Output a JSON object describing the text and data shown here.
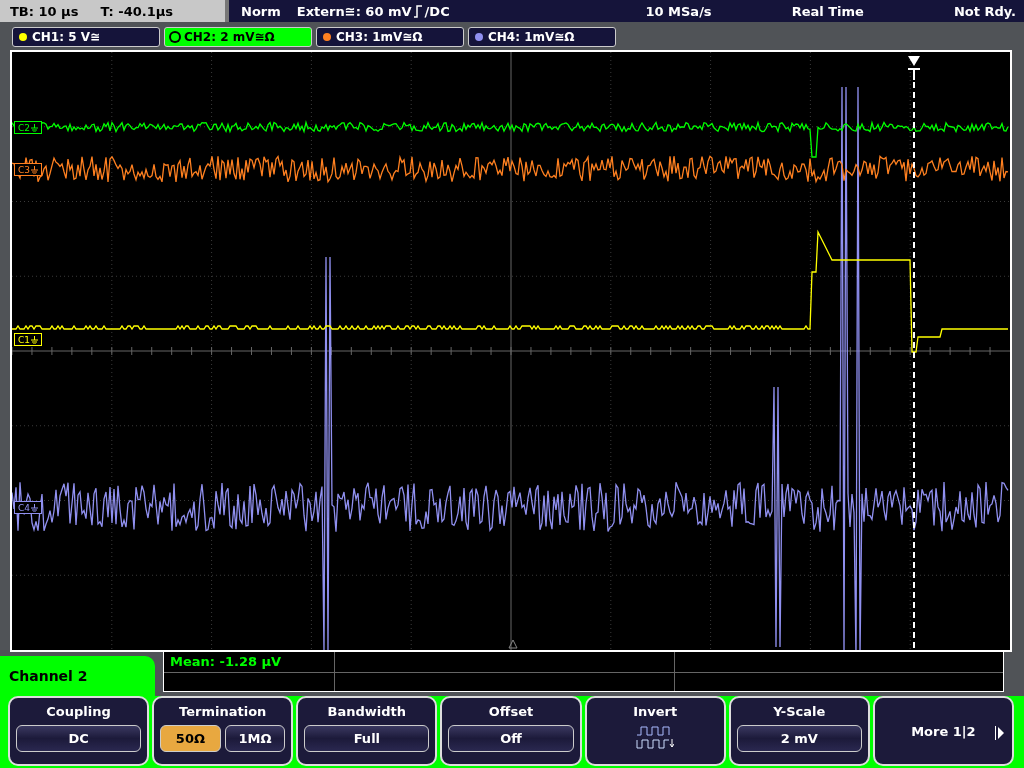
{
  "status_bar": {
    "timebase": "TB: 10 µs",
    "trigger_time": "T: -40.1µs",
    "mode": "Norm",
    "trigger_source": "Extern≅: 60 mV",
    "trigger_coupling": "/DC",
    "sample_rate": "10 MSa/s",
    "acquisition": "Real Time",
    "state": "Not Rdy."
  },
  "channels": [
    {
      "label": "CH1: 5 V≅",
      "color": "#ffff00",
      "selected": false
    },
    {
      "label": "CH2: 2 mV≅Ω",
      "color": "#00ff00",
      "selected": true
    },
    {
      "label": "CH3: 1mV≅Ω",
      "color": "#ff8020",
      "selected": false
    },
    {
      "label": "CH4: 1mV≅Ω",
      "color": "#9090f0",
      "selected": false
    }
  ],
  "markers": [
    {
      "label": "C2",
      "color": "#00ff00"
    },
    {
      "label": "C3",
      "color": "#ff8020"
    },
    {
      "label": "C1",
      "color": "#ffff00"
    },
    {
      "label": "C4",
      "color": "#9090f0"
    }
  ],
  "measurement": {
    "text": "Mean: -1.28 µV"
  },
  "menu": {
    "title": "Channel 2"
  },
  "softkeys": [
    {
      "kind": "value",
      "label": "Coupling",
      "value": "DC"
    },
    {
      "kind": "options",
      "label": "Termination",
      "options": [
        {
          "label": "50Ω",
          "selected": true
        },
        {
          "label": "1MΩ",
          "selected": false
        }
      ]
    },
    {
      "kind": "value",
      "label": "Bandwidth",
      "value": "Full"
    },
    {
      "kind": "value",
      "label": "Offset",
      "value": "Off"
    },
    {
      "kind": "icon",
      "label": "Invert"
    },
    {
      "kind": "value",
      "label": "Y-Scale",
      "value": "2 mV"
    },
    {
      "kind": "more",
      "label": "More 1|2"
    }
  ]
}
